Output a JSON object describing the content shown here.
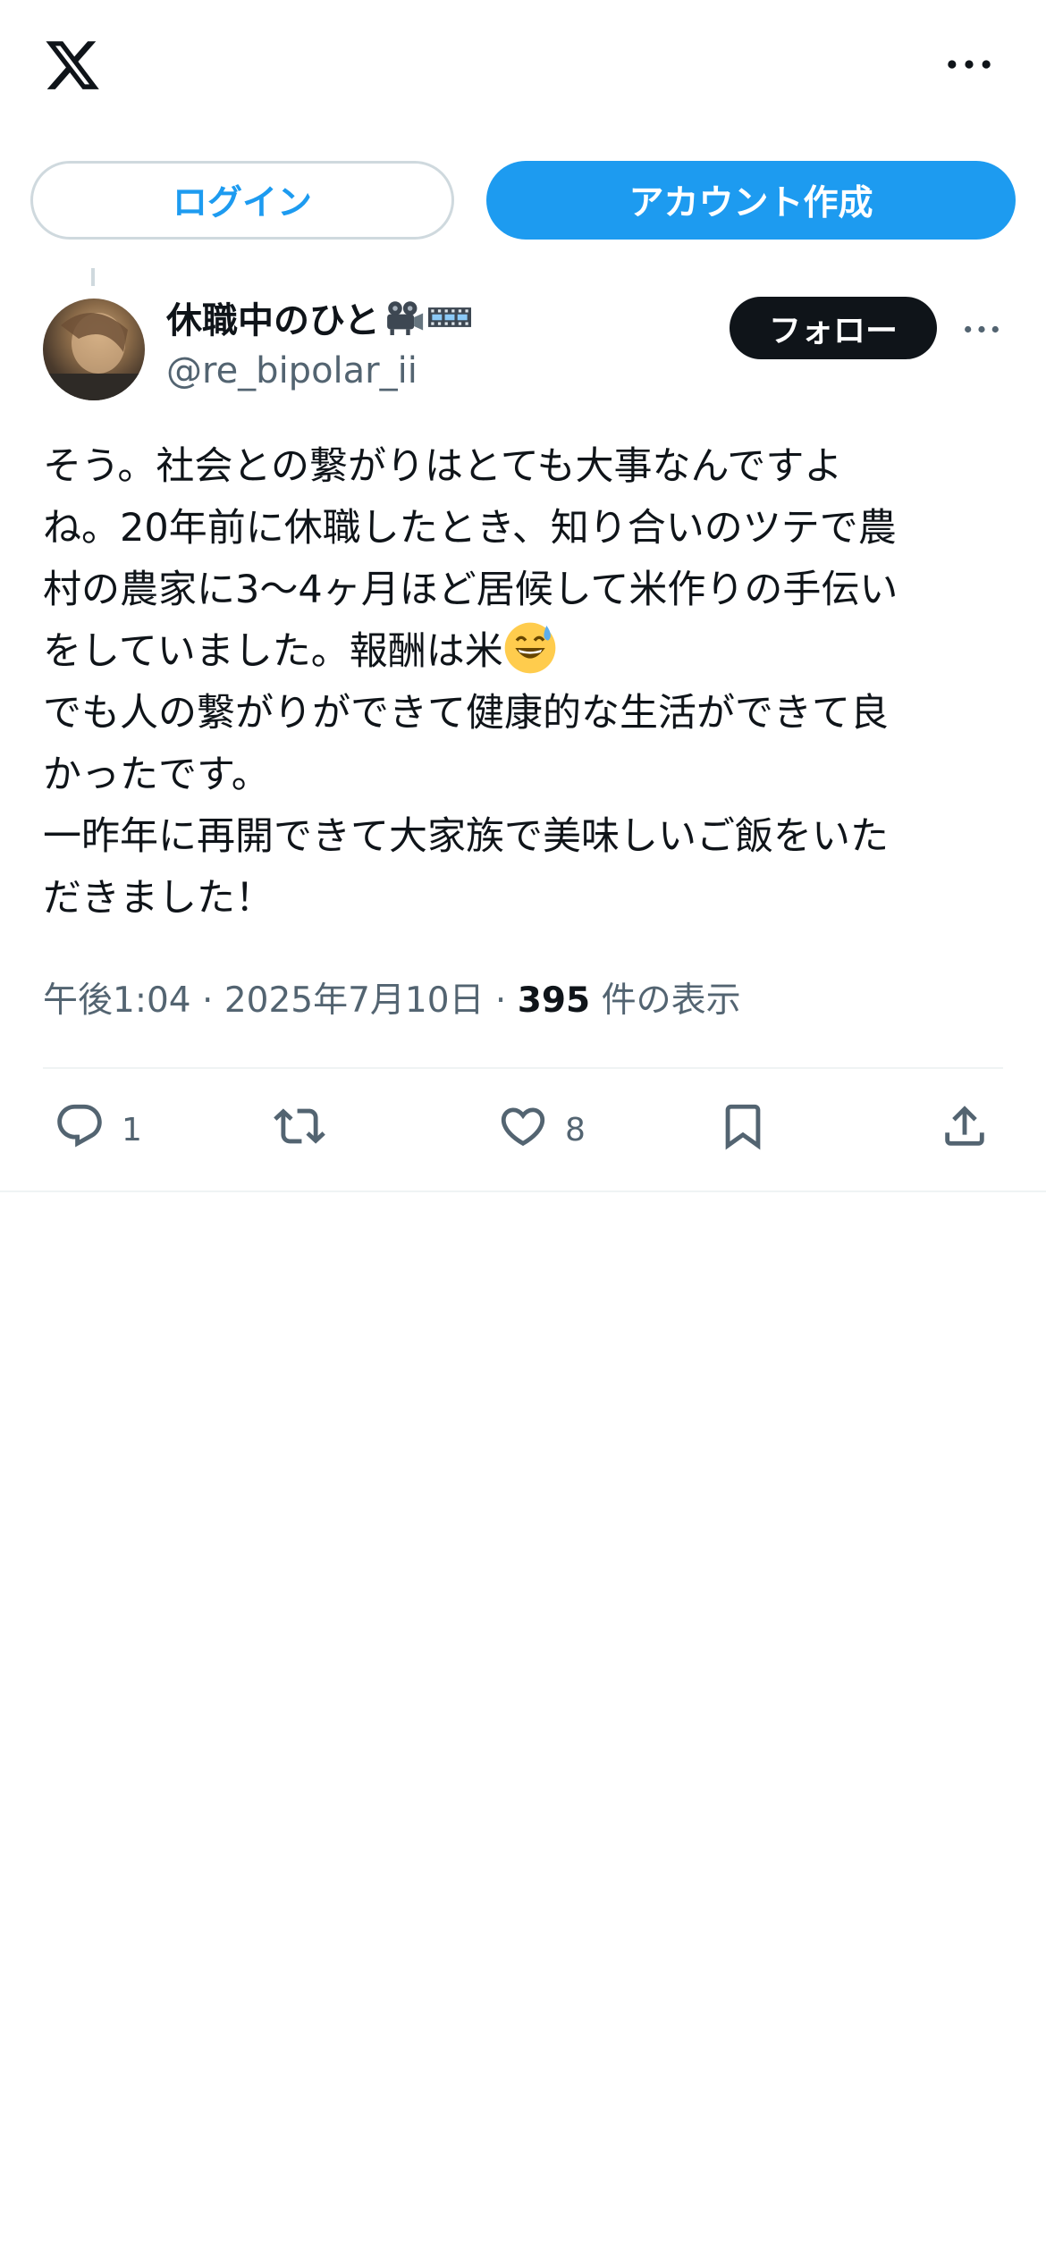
{
  "header": {
    "logo_icon": "x-logo-icon",
    "more_icon": "more-horizontal-icon"
  },
  "auth": {
    "login_label": "ログイン",
    "signup_label": "アカウント作成"
  },
  "tweet": {
    "author_name": "休職中のひと",
    "author_emojis": [
      "movie-camera-icon",
      "film-frames-icon"
    ],
    "author_handle": "@re_bipolar_ii",
    "follow_label": "フォロー",
    "body_lines": [
      "そう。社会との繋がりはとても大事なんですよ",
      "ね。20年前に休職したとき、知り合いのツテで農",
      "村の農家に3〜4ヶ月ほど居候して米作りの手伝い",
      "をしていました。報酬は米",
      "でも人の繋がりができて健康的な生活ができて良",
      "かったです。",
      "一昨年に再開できて大家族で美味しいご飯をいた",
      "だきました！"
    ],
    "body_emoji": "grinning-face-with-sweat-icon",
    "time": "午後1:04",
    "separator": "·",
    "date": "2025年7月10日",
    "views_count": "395",
    "views_label": "件の表示",
    "actions": {
      "reply_count": "1",
      "retweet_count": "",
      "like_count": "8"
    }
  },
  "colors": {
    "accent": "#1d9bf0",
    "text": "#0f1419",
    "secondary": "#536471",
    "border": "#cfd9de"
  }
}
